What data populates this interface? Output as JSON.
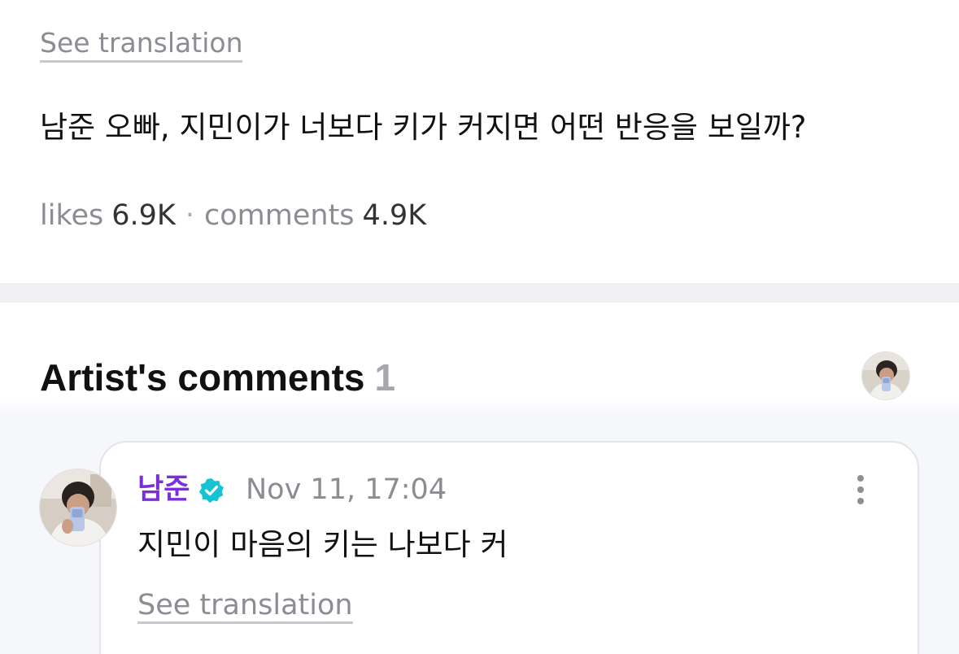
{
  "post": {
    "see_translation_label": "See translation",
    "body_text": "남준 오빠, 지민이가 너보다 키가 커지면 어떤 반응을 보일까?",
    "stats": {
      "likes_label": "likes",
      "likes_value": "6.9K",
      "separator": "·",
      "comments_label": "comments",
      "comments_value": "4.9K"
    }
  },
  "artist_comments": {
    "title": "Artist's comments",
    "count": "1",
    "comment": {
      "author": "남준",
      "verified_icon": "verified-check-icon",
      "timestamp": "Nov 11, 17:04",
      "text": "지민이 마음의 키는 나보다 커",
      "see_translation_label": "See translation",
      "more_icon": "more-vertical-icon"
    }
  },
  "colors": {
    "muted_text": "#8c8c92",
    "author_purple": "#7b2fd8",
    "verified_teal": "#12c4d4",
    "separator_gray": "#f0f0f2",
    "card_border": "#e3e3e8"
  }
}
